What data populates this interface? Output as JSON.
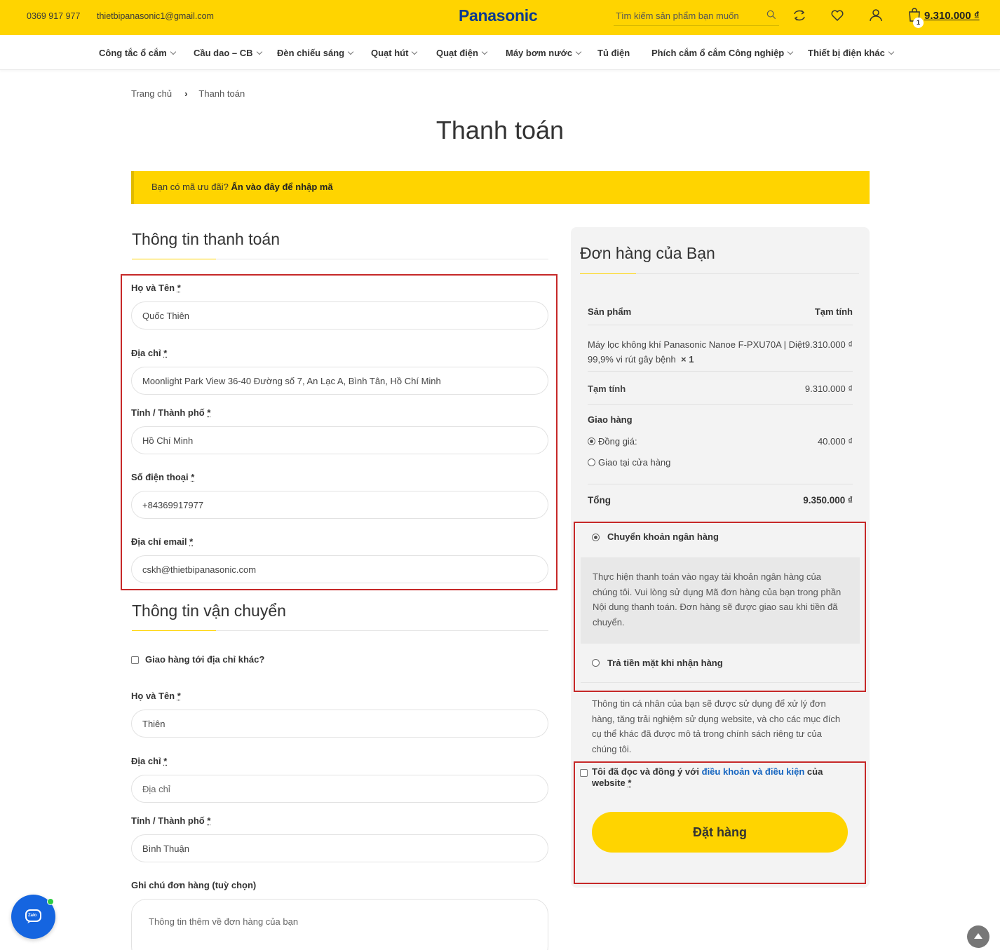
{
  "topbar": {
    "phone": "0369 917 977",
    "email": "thietbipanasonic1@gmail.com",
    "logo": "Panasonic",
    "search_placeholder": "Tìm kiếm sản phẩm bạn muốn",
    "cart_count": "1",
    "cart_total": "9.310.000 ₫",
    "icons": [
      "search-icon",
      "compare-icon",
      "heart-icon",
      "user-icon",
      "cart-icon"
    ],
    "color": "#ffd400"
  },
  "nav": {
    "items": [
      {
        "label": "Công tắc ổ cắm",
        "dropdown": true
      },
      {
        "label": "Cầu dao – CB",
        "dropdown": true
      },
      {
        "label": "Đèn chiếu sáng",
        "dropdown": true
      },
      {
        "label": "Quạt hút",
        "dropdown": true
      },
      {
        "label": "Quạt điện",
        "dropdown": true
      },
      {
        "label": "Máy bơm nước",
        "dropdown": true
      },
      {
        "label": "Tủ điện",
        "dropdown": false
      },
      {
        "label": "Phích cắm ổ cắm Công nghiệp",
        "dropdown": true
      },
      {
        "label": "Thiết bị điện khác",
        "dropdown": true
      }
    ]
  },
  "breadcrumb": {
    "home": "Trang chủ",
    "current": "Thanh toán"
  },
  "page_title": "Thanh toán",
  "coupon": {
    "text": "Bạn có mã ưu đãi?",
    "link": "Ấn vào đây để nhập mã"
  },
  "billing": {
    "title": "Thông tin thanh toán",
    "fields": [
      {
        "label": "Họ và Tên",
        "value": "Quốc Thiên"
      },
      {
        "label": "Địa chỉ",
        "value": "Moonlight Park View 36-40 Đường số 7, An Lạc A, Bình Tân, Hồ Chí Minh"
      },
      {
        "label": "Tỉnh / Thành phố",
        "value": "Hồ Chí Minh"
      },
      {
        "label": "Số điện thoại",
        "value": "+84369917977"
      },
      {
        "label": "Địa chỉ email",
        "value": "cskh@thietbipanasonic.com"
      }
    ]
  },
  "shipping": {
    "title": "Thông tin vận chuyển",
    "different_address_label": "Giao hàng tới địa chỉ khác?",
    "fields": [
      {
        "label": "Họ và Tên",
        "value": "Thiên",
        "placeholder": ""
      },
      {
        "label": "Địa chỉ",
        "value": "",
        "placeholder": "Địa chỉ"
      },
      {
        "label": "Tỉnh / Thành phố",
        "value": "Bình Thuận",
        "placeholder": ""
      }
    ],
    "notes_label": "Ghi chú đơn hàng (tuỳ chọn)",
    "notes_placeholder": "Thông tin thêm về đơn hàng của bạn"
  },
  "order": {
    "title": "Đơn hàng của Bạn",
    "col_product": "Sản phẩm",
    "col_subtotal": "Tạm tính",
    "item_name_line1": "Máy lọc không khí Panasonic Nanoe F-PXU70A | Diệt",
    "item_name_line2": "99,9% vi rút gây bệnh",
    "item_qty": "× 1",
    "item_price": "9.310.000 ₫",
    "subtotal_label": "Tạm tính",
    "subtotal_value": "9.310.000 ₫",
    "shipping_label": "Giao hàng",
    "ship_opt1_label": "Đồng giá:",
    "ship_opt1_value": "40.000 ₫",
    "ship_opt2_label": "Giao tại cửa hàng",
    "total_label": "Tổng",
    "total_value": "9.350.000 ₫"
  },
  "payment": {
    "bank_label": "Chuyển khoản ngân hàng",
    "bank_desc": "Thực hiện thanh toán vào ngay tài khoản ngân hàng của chúng tôi. Vui lòng sử dụng Mã đơn hàng của bạn trong phần Nội dung thanh toán. Đơn hàng sẽ được giao sau khi tiền đã chuyển.",
    "cod_label": "Trả tiền mặt khi nhận hàng",
    "privacy_text": "Thông tin cá nhân của bạn sẽ được sử dụng để xử lý đơn hàng, tăng trải nghiệm sử dụng website, và cho các mục đích cụ thể khác đã được mô tả trong chính sách riêng tư của chúng tôi.",
    "terms_prefix": "Tôi đã đọc và đồng ý với",
    "terms_link": "điều khoản và điều kiện",
    "terms_suffix": "của",
    "terms_line2": "website",
    "place_order": "Đặt hàng"
  },
  "widgets": {
    "zalo_label": "Zalo"
  }
}
